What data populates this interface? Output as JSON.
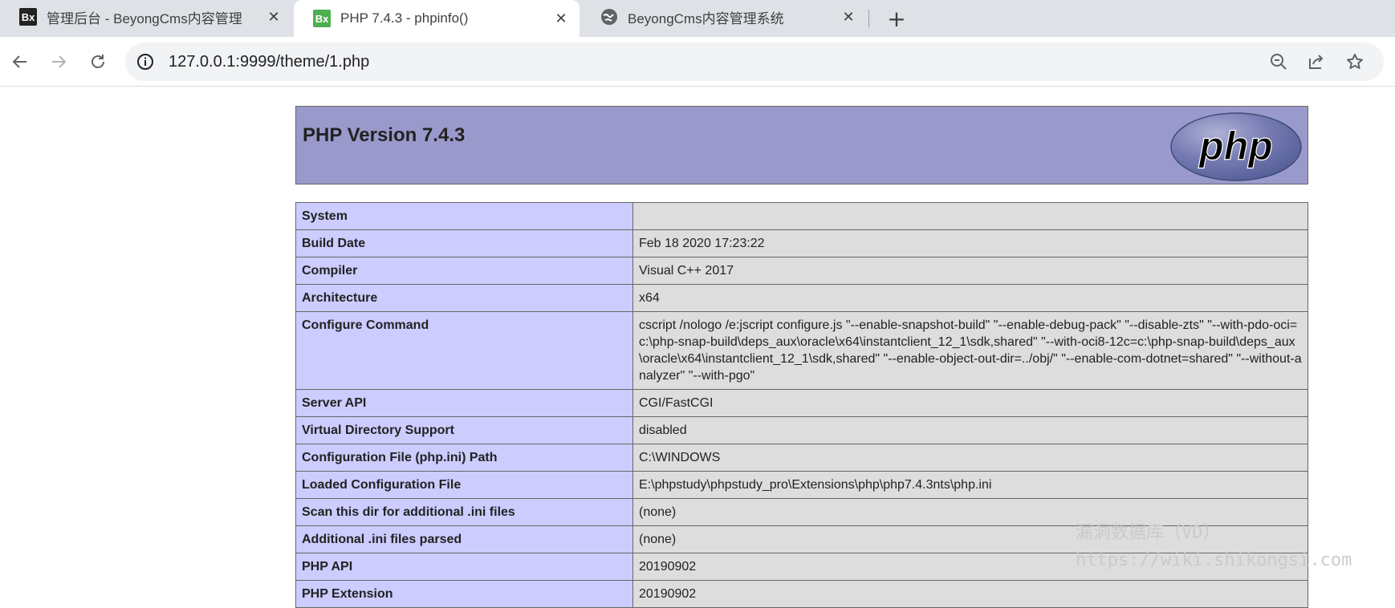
{
  "browser": {
    "tabs": [
      {
        "favicon": "Bx",
        "title": "管理后台 - BeyongCms内容管理",
        "active": false
      },
      {
        "favicon": "Bx",
        "title": "PHP 7.4.3 - phpinfo()",
        "active": true
      },
      {
        "favicon": "globe-icon",
        "title": "BeyongCms内容管理系统",
        "active": false
      }
    ],
    "new_tab_label": "+",
    "url": "127.0.0.1:9999/theme/1.php"
  },
  "phpinfo": {
    "title": "PHP Version 7.4.3",
    "logo_text": "php",
    "rows": [
      {
        "key": "System",
        "value": ""
      },
      {
        "key": "Build Date",
        "value": "Feb 18 2020 17:23:22"
      },
      {
        "key": "Compiler",
        "value": "Visual C++ 2017"
      },
      {
        "key": "Architecture",
        "value": "x64"
      },
      {
        "key": "Configure Command",
        "value": "cscript /nologo /e:jscript configure.js \"--enable-snapshot-build\" \"--enable-debug-pack\" \"--disable-zts\" \"--with-pdo-oci=c:\\php-snap-build\\deps_aux\\oracle\\x64\\instantclient_12_1\\sdk,shared\" \"--with-oci8-12c=c:\\php-snap-build\\deps_aux\\oracle\\x64\\instantclient_12_1\\sdk,shared\" \"--enable-object-out-dir=../obj/\" \"--enable-com-dotnet=shared\" \"--without-analyzer\" \"--with-pgo\""
      },
      {
        "key": "Server API",
        "value": "CGI/FastCGI"
      },
      {
        "key": "Virtual Directory Support",
        "value": "disabled"
      },
      {
        "key": "Configuration File (php.ini) Path",
        "value": "C:\\WINDOWS"
      },
      {
        "key": "Loaded Configuration File",
        "value": "E:\\phpstudy\\phpstudy_pro\\Extensions\\php\\php7.4.3nts\\php.ini"
      },
      {
        "key": "Scan this dir for additional .ini files",
        "value": "(none)"
      },
      {
        "key": "Additional .ini files parsed",
        "value": "(none)"
      },
      {
        "key": "PHP API",
        "value": "20190902"
      },
      {
        "key": "PHP Extension",
        "value": "20190902"
      }
    ]
  },
  "watermark": {
    "line1": "漏洞数据库（VD）",
    "line2": "https://wiki.shikongsi.com"
  },
  "colors": {
    "header_bg": "#9999cc",
    "key_cell_bg": "#ccccff",
    "value_cell_bg": "#dddddd",
    "tabstrip_bg": "#dee1e6"
  }
}
